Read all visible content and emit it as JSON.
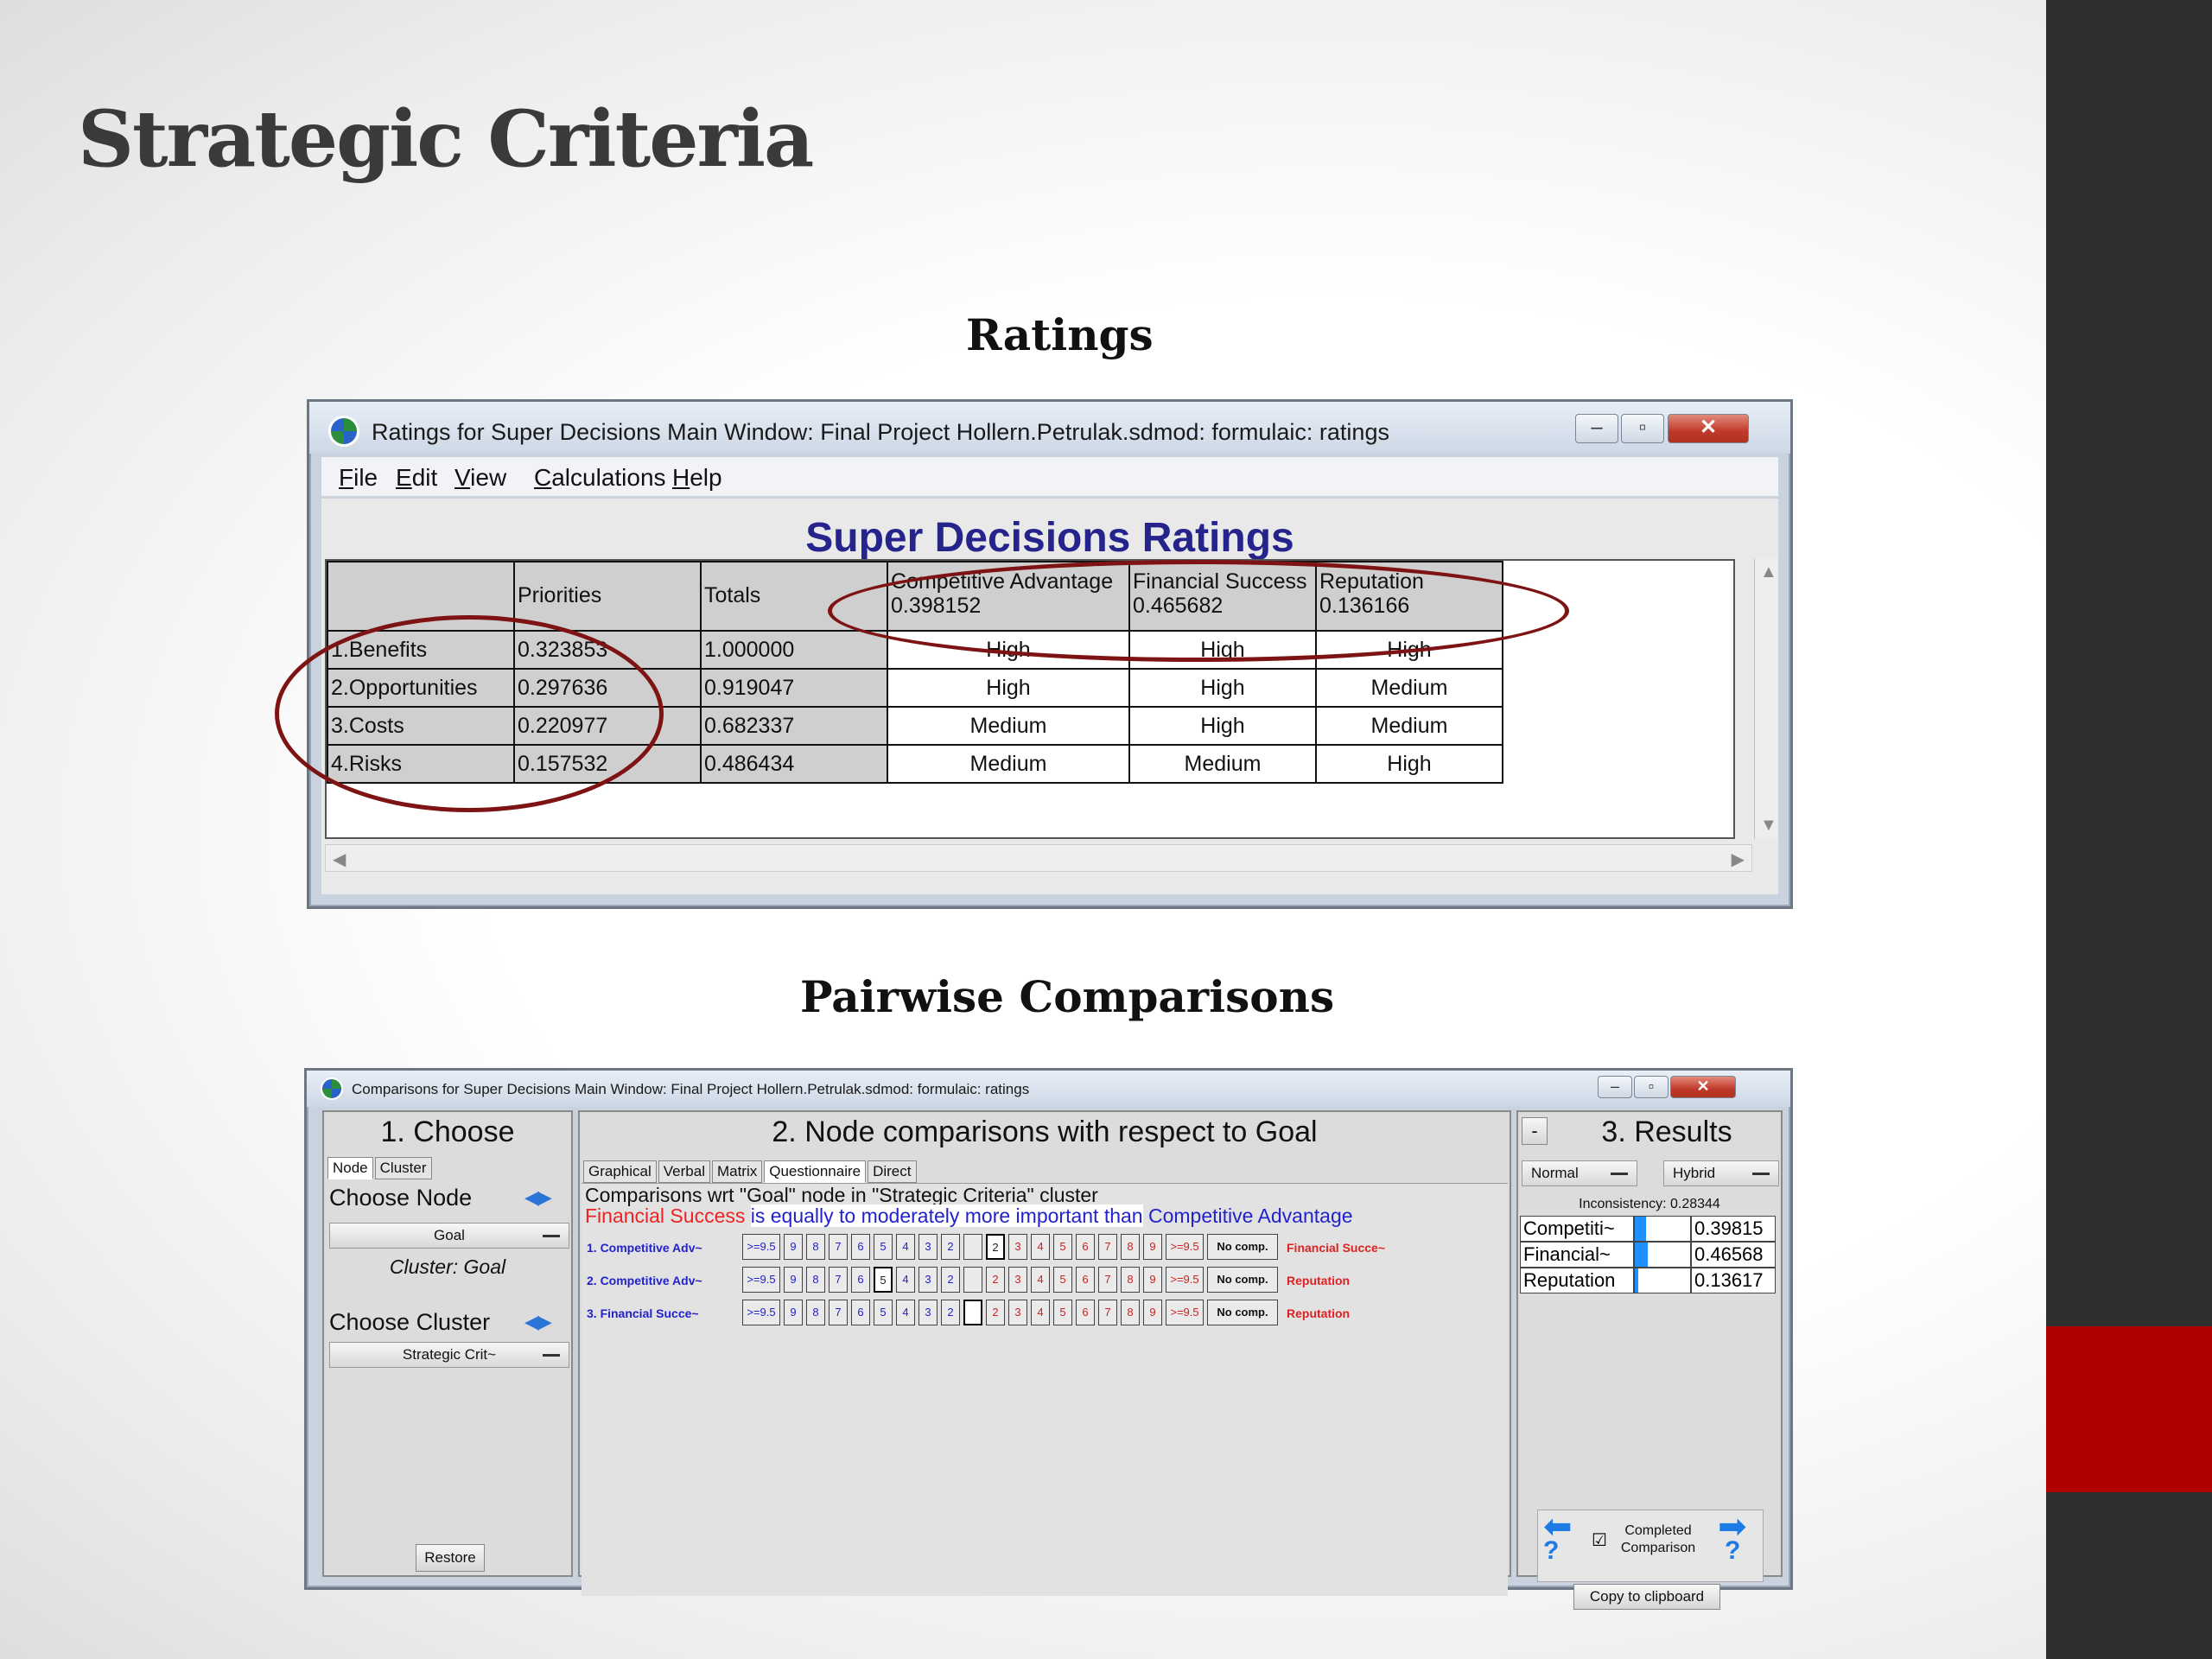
{
  "slide": {
    "title": "Strategic Criteria",
    "ratings_heading": "Ratings",
    "pairwise_heading": "Pairwise Comparisons"
  },
  "ratings_window": {
    "title": "Ratings for Super Decisions Main Window: Final Project Hollern.Petrulak.sdmod: formulaic: ratings",
    "menu": [
      "File",
      "Edit",
      "View",
      "Calculations",
      "Help"
    ],
    "heading": "Super Decisions Ratings",
    "columns": {
      "priorities": "Priorities",
      "totals": "Totals"
    },
    "criteria": [
      {
        "name": "Competitive Advantage",
        "weight": "0.398152"
      },
      {
        "name": "Financial Success",
        "weight": "0.465682"
      },
      {
        "name": "Reputation",
        "weight": "0.136166"
      }
    ],
    "rows": [
      {
        "name": "1.Benefits",
        "priority": "0.323853",
        "total": "1.000000",
        "ratings": [
          "High",
          "High",
          "High"
        ]
      },
      {
        "name": "2.Opportunities",
        "priority": "0.297636",
        "total": "0.919047",
        "ratings": [
          "High",
          "High",
          "Medium"
        ]
      },
      {
        "name": "3.Costs",
        "priority": "0.220977",
        "total": "0.682337",
        "ratings": [
          "Medium",
          "High",
          "Medium"
        ]
      },
      {
        "name": "4.Risks",
        "priority": "0.157532",
        "total": "0.486434",
        "ratings": [
          "Medium",
          "Medium",
          "High"
        ]
      }
    ]
  },
  "comparisons_window": {
    "title": "Comparisons for Super Decisions Main Window: Final Project Hollern.Petrulak.sdmod: formulaic: ratings",
    "choose": {
      "heading": "1. Choose",
      "tabs": [
        "Node",
        "Cluster"
      ],
      "choose_node": "Choose Node",
      "node_value": "Goal",
      "cluster_label": "Cluster: Goal",
      "choose_cluster": "Choose Cluster",
      "cluster_value": "Strategic Crit~",
      "restore": "Restore"
    },
    "node": {
      "heading": "2. Node comparisons with respect to Goal",
      "tabs": [
        "Graphical",
        "Verbal",
        "Matrix",
        "Questionnaire",
        "Direct"
      ],
      "desc": "Comparisons wrt \"Goal\" node in \"Strategic Criteria\" cluster",
      "verdict_left": "Financial Success",
      "verdict_mid": "is equally to moderately more important than",
      "verdict_right": "Competitive Advantage",
      "scale_left": [
        ">=9.5",
        "9",
        "8",
        "7",
        "6",
        "5",
        "4",
        "3",
        "2"
      ],
      "scale_right": [
        "2",
        "3",
        "4",
        "5",
        "6",
        "7",
        "8",
        "9",
        ">=9.5"
      ],
      "no_comp": "No comp.",
      "rows": [
        {
          "num": "1.",
          "left": "Competitive Adv~",
          "right": "Financial Succe~"
        },
        {
          "num": "2.",
          "left": "Competitive Adv~",
          "right": "Reputation"
        },
        {
          "num": "3.",
          "left": "Financial Succe~",
          "right": "Reputation"
        }
      ]
    },
    "results": {
      "heading": "3. Results",
      "collapse": "-",
      "mode1": "Normal",
      "mode2": "Hybrid",
      "inconsistency": "Inconsistency: 0.28344",
      "items": [
        {
          "name": "Competiti~",
          "value": "0.39815",
          "fraction": 0.39815
        },
        {
          "name": "Financial~",
          "value": "0.46568",
          "fraction": 0.46568
        },
        {
          "name": "Reputation",
          "value": "0.13617",
          "fraction": 0.13617
        }
      ],
      "completed": "Completed Comparison",
      "copy": "Copy to clipboard",
      "checkmark": "☑"
    }
  }
}
